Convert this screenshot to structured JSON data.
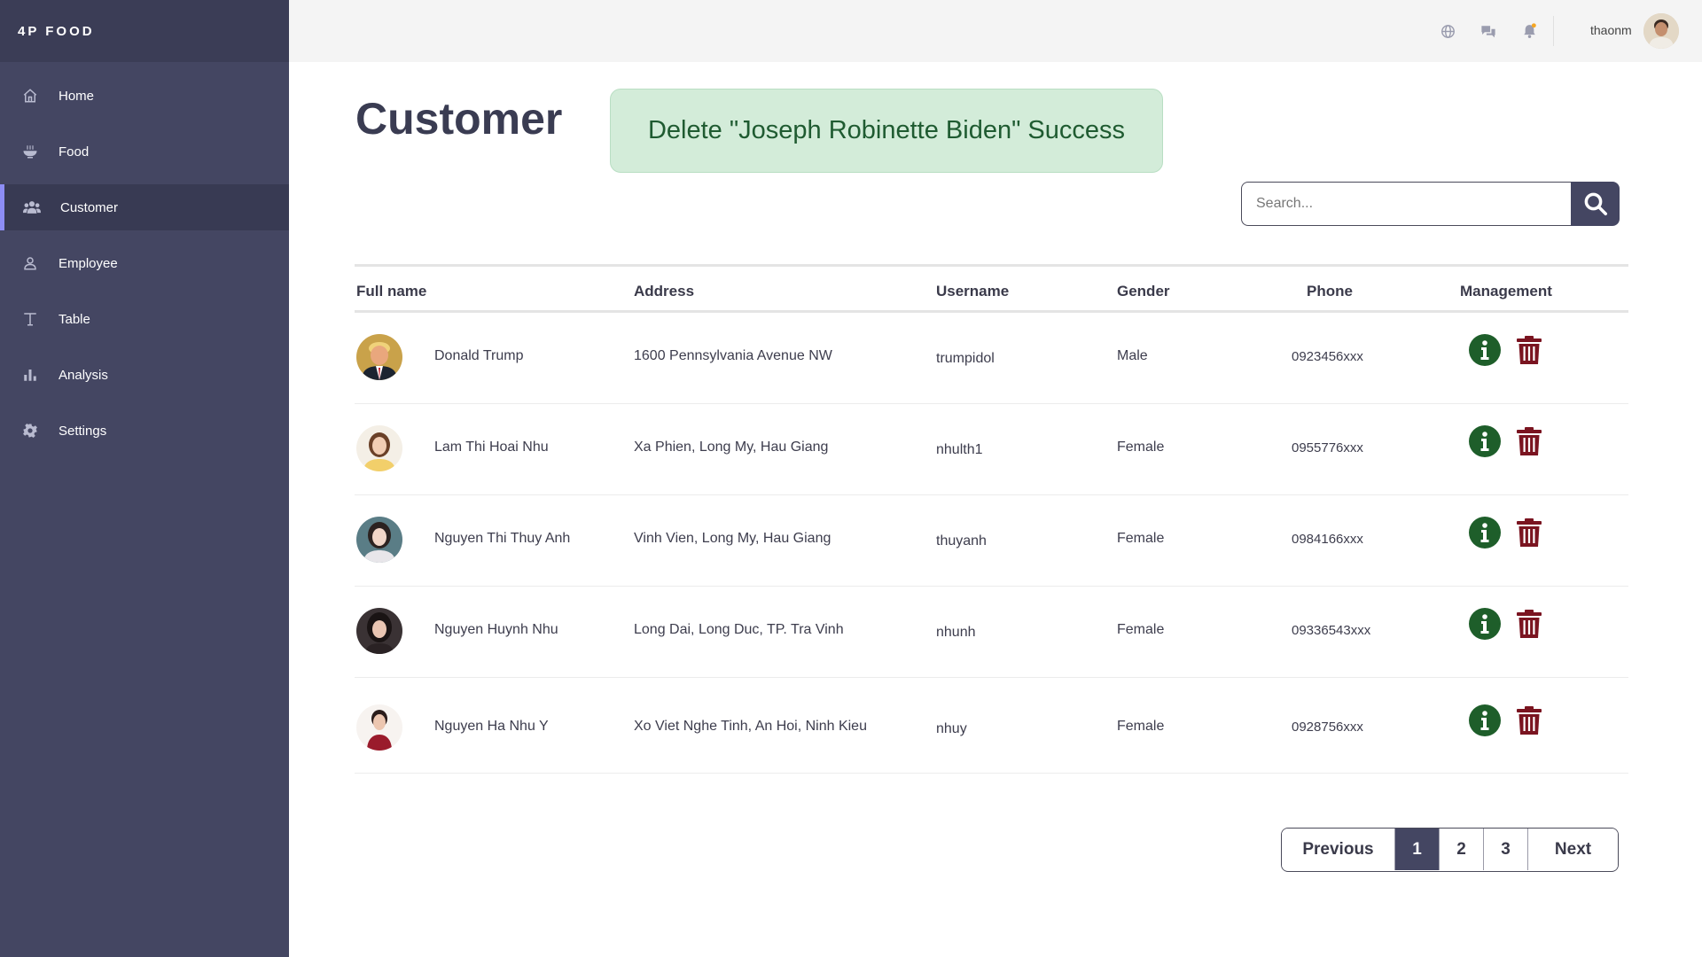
{
  "brand": "4P FOOD",
  "sidebar": {
    "items": [
      {
        "label": "Home",
        "icon": "home-icon"
      },
      {
        "label": "Food",
        "icon": "bowl-icon"
      },
      {
        "label": "Customer",
        "icon": "users-icon",
        "active": true
      },
      {
        "label": "Employee",
        "icon": "user-icon"
      },
      {
        "label": "Table",
        "icon": "table-icon"
      },
      {
        "label": "Analysis",
        "icon": "bar-chart-icon"
      },
      {
        "label": "Settings",
        "icon": "gear-icon"
      }
    ]
  },
  "topbar": {
    "icons": [
      "globe-icon",
      "chat-icon",
      "bell-icon"
    ],
    "notification_dot_color": "#f5a623",
    "username": "thaonm"
  },
  "page": {
    "title": "Customer",
    "toast": "Delete \"Joseph Robinette Biden\" Success"
  },
  "search": {
    "placeholder": "Search..."
  },
  "table": {
    "headers": {
      "fullname": "Full name",
      "address": "Address",
      "username": "Username",
      "gender": "Gender",
      "phone": "Phone",
      "management": "Management"
    },
    "rows": [
      {
        "name": "Donald Trump",
        "address": "1600 Pennsylvania Avenue NW",
        "username": "trumpidol",
        "gender": "Male",
        "phone": "0923456xxx"
      },
      {
        "name": "Lam Thi Hoai Nhu",
        "address": "Xa Phien, Long My, Hau Giang",
        "username": "nhulth1",
        "gender": "Female",
        "phone": "0955776xxx"
      },
      {
        "name": "Nguyen Thi Thuy Anh",
        "address": "Vinh Vien, Long My, Hau Giang",
        "username": "thuyanh",
        "gender": "Female",
        "phone": "0984166xxx"
      },
      {
        "name": "Nguyen Huynh Nhu",
        "address": "Long Dai, Long Duc, TP. Tra Vinh",
        "username": "nhunh",
        "gender": "Female",
        "phone": "09336543xxx"
      },
      {
        "name": "Nguyen Ha Nhu Y",
        "address": "Xo Viet Nghe Tinh, An Hoi, Ninh Kieu",
        "username": "nhuy",
        "gender": "Female",
        "phone": "0928756xxx"
      }
    ]
  },
  "pagination": {
    "previous": "Previous",
    "pages": [
      "1",
      "2",
      "3"
    ],
    "current": "1",
    "next": "Next"
  },
  "colors": {
    "sidebar": "#444662",
    "accent": "#8d8df5",
    "toast_bg": "#d3ecd9",
    "info": "#1e5e2a",
    "delete": "#7a1420"
  }
}
